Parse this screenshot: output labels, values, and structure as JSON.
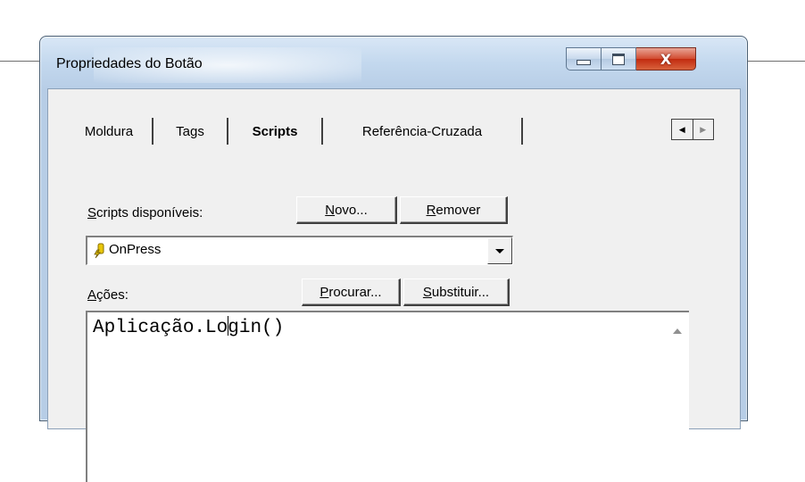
{
  "window": {
    "title": "Propriedades do Botão",
    "close_glyph": "X"
  },
  "tabs": [
    {
      "label": "Moldura",
      "selected": false
    },
    {
      "label": "Tags",
      "selected": false
    },
    {
      "label": "Scripts",
      "selected": true
    },
    {
      "label": "Referência-Cruzada",
      "selected": false
    }
  ],
  "scripts": {
    "available_label_prefix": "S",
    "available_label_rest": "cripts disponíveis:",
    "new_button_prefix": "N",
    "new_button_rest": "ovo...",
    "remove_button_prefix": "R",
    "remove_button_rest": "emover",
    "selected_script": "OnPress",
    "actions_label_prefix": "A",
    "actions_label_rest": "ções:",
    "find_button_prefix": "P",
    "find_button_rest": "rocurar...",
    "replace_button_prefix": "S",
    "replace_button_rest": "ubstituir..."
  },
  "editor": {
    "code_before_caret": "Aplicação.Lo",
    "code_after_caret": "gin()"
  },
  "icons": {
    "script": "script-bolt-icon",
    "dropdown": "chevron-down-icon"
  },
  "colors": {
    "accent_close": "#c22b10",
    "frame": "#b7cde6"
  }
}
